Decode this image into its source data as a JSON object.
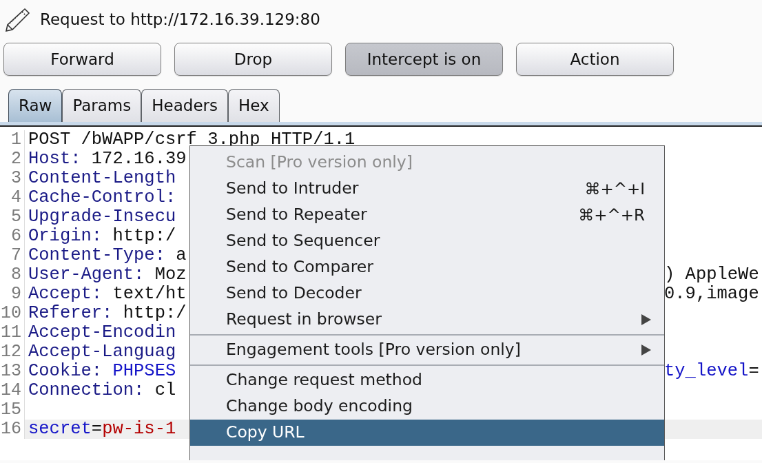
{
  "title": "Request to http://172.16.39.129:80",
  "buttons": [
    {
      "label": "Forward",
      "pressed": false
    },
    {
      "label": "Drop",
      "pressed": false
    },
    {
      "label": "Intercept is on",
      "pressed": true
    },
    {
      "label": "Action",
      "pressed": false
    }
  ],
  "tabs": [
    {
      "label": "Raw",
      "selected": true
    },
    {
      "label": "Params",
      "selected": false
    },
    {
      "label": "Headers",
      "selected": false
    },
    {
      "label": "Hex",
      "selected": false
    }
  ],
  "lines": [
    {
      "number": "1",
      "highlighted": false,
      "left": [
        {
          "kind": "text",
          "text": "POST /bWAPP/csrf_3.php HTTP/1.1"
        }
      ]
    },
    {
      "number": "2",
      "highlighted": false,
      "left": [
        {
          "kind": "header_name",
          "text": "Host:"
        },
        {
          "kind": "text",
          "text": " 172.16.39"
        }
      ]
    },
    {
      "number": "3",
      "highlighted": false,
      "left": [
        {
          "kind": "header_name",
          "text": "Content-Length"
        }
      ]
    },
    {
      "number": "4",
      "highlighted": false,
      "left": [
        {
          "kind": "header_name",
          "text": "Cache-Control:"
        }
      ]
    },
    {
      "number": "5",
      "highlighted": false,
      "left": [
        {
          "kind": "header_name",
          "text": "Upgrade-Insecu"
        }
      ]
    },
    {
      "number": "6",
      "highlighted": false,
      "left": [
        {
          "kind": "header_name",
          "text": "Origin:"
        },
        {
          "kind": "text",
          "text": " http:/"
        }
      ]
    },
    {
      "number": "7",
      "highlighted": false,
      "left": [
        {
          "kind": "header_name",
          "text": "Content-Type:"
        },
        {
          "kind": "text",
          "text": " a"
        }
      ]
    },
    {
      "number": "8",
      "highlighted": false,
      "left": [
        {
          "kind": "header_name",
          "text": "User-Agent:"
        },
        {
          "kind": "text",
          "text": " Moz"
        }
      ],
      "right": [
        {
          "kind": "text",
          "text": ") AppleWe"
        }
      ]
    },
    {
      "number": "9",
      "highlighted": false,
      "left": [
        {
          "kind": "header_name",
          "text": "Accept:"
        },
        {
          "kind": "text",
          "text": " text/ht"
        }
      ],
      "right": [
        {
          "kind": "text",
          "text": "0.9,image"
        }
      ]
    },
    {
      "number": "10",
      "highlighted": false,
      "left": [
        {
          "kind": "header_name",
          "text": "Referer:"
        },
        {
          "kind": "text",
          "text": " http:/"
        }
      ]
    },
    {
      "number": "11",
      "highlighted": false,
      "left": [
        {
          "kind": "header_name",
          "text": "Accept-Encodin"
        }
      ]
    },
    {
      "number": "12",
      "highlighted": false,
      "left": [
        {
          "kind": "header_name",
          "text": "Accept-Languag"
        }
      ]
    },
    {
      "number": "13",
      "highlighted": false,
      "left": [
        {
          "kind": "header_name",
          "text": "Cookie:"
        },
        {
          "kind": "cookie_name",
          "text": " PHPSES"
        }
      ],
      "right": [
        {
          "kind": "cookie_name",
          "text": "ty_level"
        },
        {
          "kind": "text",
          "text": "="
        }
      ]
    },
    {
      "number": "14",
      "highlighted": false,
      "left": [
        {
          "kind": "header_name",
          "text": "Connection:"
        },
        {
          "kind": "text",
          "text": " cl"
        }
      ]
    },
    {
      "number": "15",
      "highlighted": false
    },
    {
      "number": "16",
      "highlighted": true,
      "left": [
        {
          "kind": "param_name",
          "text": "secret"
        },
        {
          "kind": "text",
          "text": "="
        },
        {
          "kind": "param_value",
          "text": "pw-is-1"
        }
      ]
    }
  ],
  "context_menu": [
    {
      "label": "Scan [Pro version only]",
      "disabled": true,
      "selected": false
    },
    {
      "label": "Send to Intruder",
      "shortcut": "⌘+^+I",
      "disabled": false,
      "selected": false
    },
    {
      "label": "Send to Repeater",
      "shortcut": "⌘+^+R",
      "disabled": false,
      "selected": false
    },
    {
      "label": "Send to Sequencer",
      "disabled": false,
      "selected": false
    },
    {
      "label": "Send to Comparer",
      "disabled": false,
      "selected": false
    },
    {
      "label": "Send to Decoder",
      "disabled": false,
      "selected": false
    },
    {
      "label": "Request in browser",
      "submenu": true,
      "disabled": false,
      "selected": false,
      "separator_after": true
    },
    {
      "label": "Engagement tools [Pro version only]",
      "submenu": true,
      "disabled": false,
      "selected": false,
      "separator_after": true
    },
    {
      "label": "Change request method",
      "disabled": false,
      "selected": false
    },
    {
      "label": "Change body encoding",
      "disabled": false,
      "selected": false
    },
    {
      "label": "Copy URL",
      "disabled": false,
      "selected": true
    }
  ]
}
